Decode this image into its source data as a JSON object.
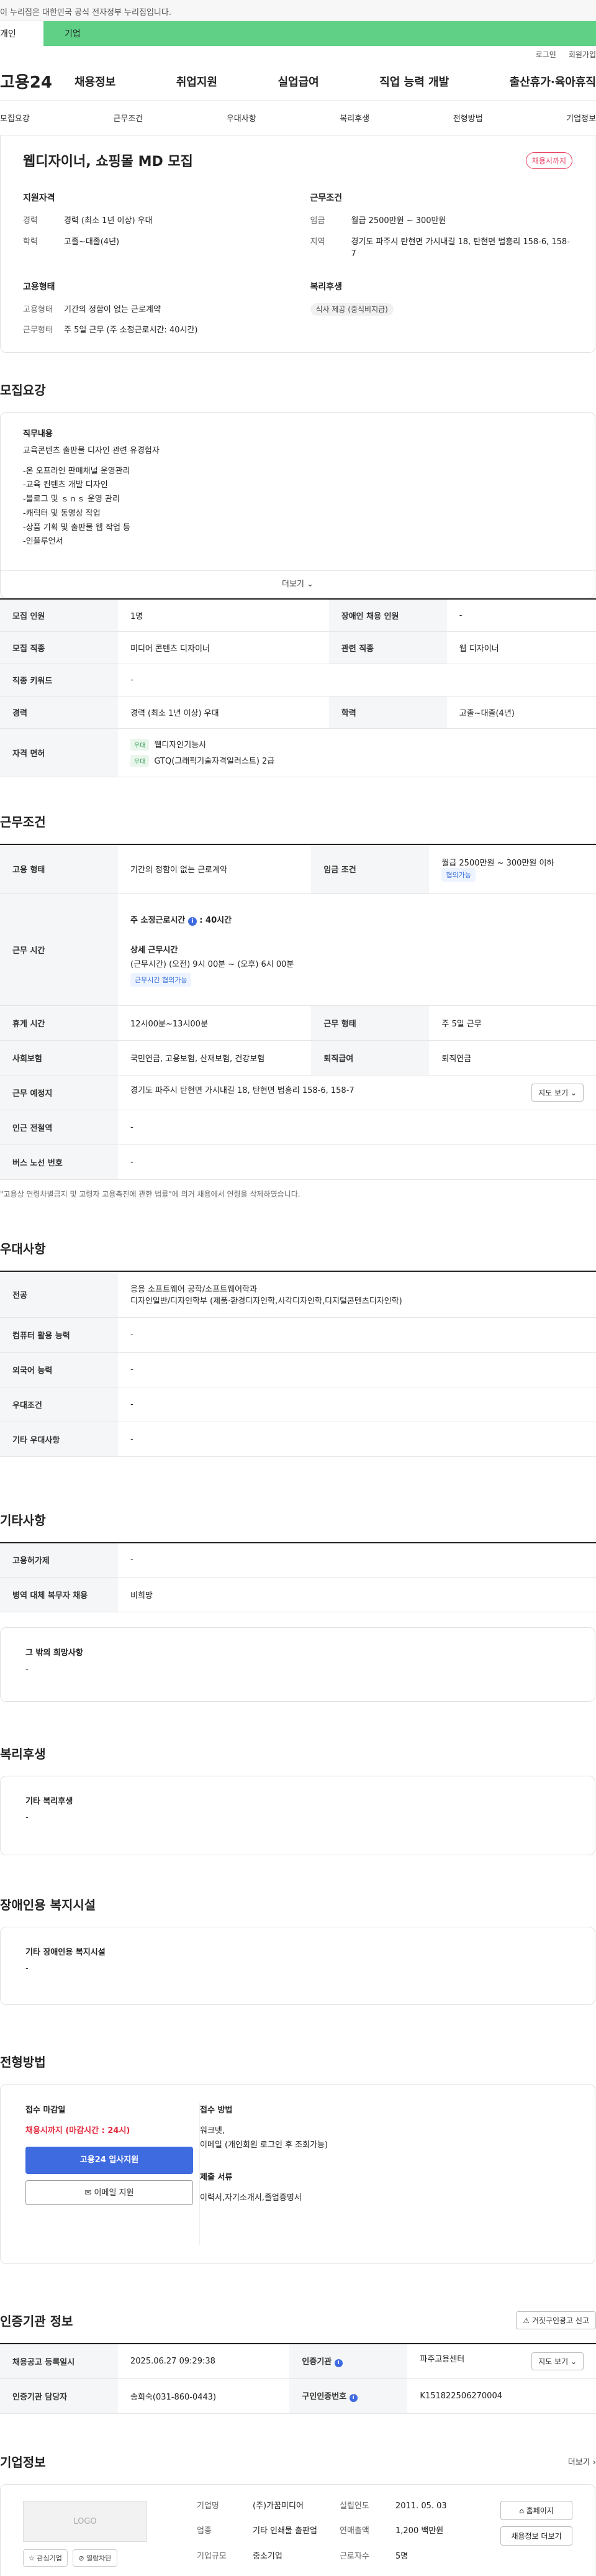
{
  "topbar": {
    "gov_text": "이 누리집은 대한민국 공식 전자정부 누리집입니다.",
    "tab1": "개인",
    "tab2": "기업",
    "login": "로그인",
    "join": "회원가입"
  },
  "gnb": {
    "logo": "고용24",
    "menu": [
      "채용정보",
      "취업지원",
      "실업급여",
      "직업 능력 개발",
      "출산휴가·육아휴직"
    ]
  },
  "subnav": [
    "모집요강",
    "근무조건",
    "우대사항",
    "복리후생",
    "전형방법",
    "기업정보"
  ],
  "summary": {
    "title": "웹디자이너, 쇼핑몰 MD 모집",
    "badge": "채용시까지",
    "apply_h": "지원자격",
    "career_k": "경력",
    "career_v": "경력 (최소 1년 이상) 우대",
    "edu_k": "학력",
    "edu_v": "고졸~대졸(4년)",
    "cond_h": "근무조건",
    "wage_k": "임금",
    "wage_v": "월급 2500만원 ~ 300만원",
    "loc_k": "지역",
    "loc_v": "경기도 파주시 탄현면 가시내길 18, 탄현면 법흥리 158-6, 158-7",
    "emp_h": "고용형태",
    "etype_k": "고용형태",
    "etype_v": "기간의 정함이 없는 근로계약",
    "work_k": "근무형태",
    "work_v": "주 5일 근무 (주 소정근로시간: 40시간)",
    "welf_h": "복리후생",
    "welf_v": "식사 제공 (중식비지급)"
  },
  "recruit": {
    "h": "모집요강",
    "desc_h": "직무내용",
    "desc": [
      "교육콘텐츠 출판물 디자인 관련 유경험자",
      "",
      "-온 오프라인 판매채널 운영관리",
      "-교육 컨텐츠 개발 디자인",
      "-블로그 및 ｓｎｓ 운영 관리",
      "-캐릭터 및 동영상 작업",
      "-상품 기획 및 출판물 웹 작업 등",
      "-인플루언서"
    ],
    "more": "더보기",
    "rows": {
      "num_k": "모집 인원",
      "num_v": "1명",
      "dis_k": "장애인 채용 인원",
      "dis_v": "-",
      "job_k": "모집 직종",
      "job_v": "미디어 콘텐츠 디자이너",
      "rel_k": "관련 직종",
      "rel_v": "웹 디자이너",
      "kw_k": "직종 키워드",
      "kw_v": "-",
      "car_k": "경력",
      "car_v": "경력 (최소 1년 이상) 우대",
      "edu_k": "학력",
      "edu_v": "고졸~대졸(4년)",
      "lic_k": "자격 면허",
      "lic_tag": "우대",
      "lic1": "웹디자인기능사",
      "lic2": "GTQ(그래픽기술자격일러스트) 2급"
    }
  },
  "work": {
    "h": "근무조건",
    "emp_k": "고용 형태",
    "emp_v": "기간의 정함이 없는 근로계약",
    "wage_k": "임금 조건",
    "wage_v": "월급 2500만원 ~ 300만원 이하",
    "wage_tag": "협의가능",
    "hours_k": "근무 시간",
    "hours_t": "주 소정근로시간",
    "hours_v": "40시간",
    "detail_t": "상세 근무시간",
    "detail_v": "(근무시간) (오전) 9시 00분 ~ (오후) 6시 00분",
    "detail_tag": "근무시간 협의가능",
    "break_k": "휴게 시간",
    "break_v": "12시00분~13시00분",
    "form_k": "근무 형태",
    "form_v": "주 5일 근무",
    "ins_k": "사회보험",
    "ins_v": "국민연금, 고용보험, 산재보험, 건강보험",
    "ret_k": "퇴직급여",
    "ret_v": "퇴직연금",
    "place_k": "근무 예정지",
    "place_v": "경기도 파주시 탄현면 가시내길 18, 탄현면 법흥리 158-6, 158-7",
    "map": "지도 보기",
    "sub_k": "인근 전철역",
    "sub_v": "-",
    "bus_k": "버스 노선 번호",
    "bus_v": "-",
    "note": "\"고용상 연령차별금지 및 고령자 고용촉진에 관한 법률\"에 의거 채용에서 연령을 삭제하였습니다."
  },
  "pref": {
    "h": "우대사항",
    "maj_k": "전공",
    "maj_v1": "응용 소프트웨어 공학/소프트웨어학과",
    "maj_v2": "디자인일반/디자인학부 (제품·환경디자인학,시각디자인학,디지털콘텐츠디자인학)",
    "pc_k": "컴퓨터 활용 능력",
    "pc_v": "-",
    "lang_k": "외국어 능력",
    "lang_v": "-",
    "cond_k": "우대조건",
    "cond_v": "-",
    "etc_k": "기타 우대사항",
    "etc_v": "-"
  },
  "other": {
    "h": "기타사항",
    "emp_k": "고용허가제",
    "emp_v": "-",
    "mil_k": "병역 대체 복무자 채용",
    "mil_v": "비희망",
    "hope_h": "그 밖의 희망사항",
    "hope_v": "-"
  },
  "welfare": {
    "h": "복리후생",
    "etc_h": "기타 복리후생",
    "etc_v": "-"
  },
  "disab": {
    "h": "장애인용 복지시설",
    "etc_h": "기타 장애인용 복지시설",
    "etc_v": "-"
  },
  "process": {
    "h": "전형방법",
    "deadline_h": "접수 마감일",
    "deadline_v": "채용시까지 (마감시간 : 24시)",
    "btn1": "고용24 입사지원",
    "btn2": "이메일 지원",
    "method_h": "접수 방법",
    "method_v1": "워크넷,",
    "method_v2": "이메일 (개인회원 로그인 후 조회가능)",
    "docs_h": "제출 서류",
    "docs_v": "이력서,자기소개서,졸업증명서"
  },
  "auth": {
    "h": "인증기관 정보",
    "report": "거짓구인광고 신고",
    "reg_k": "채용공고 등록일시",
    "reg_v": "2025.06.27 09:29:38",
    "org_k": "인증기관",
    "org_v": "파주고용센터",
    "map": "지도 보기",
    "mgr_k": "인증기관 담당자",
    "mgr_v": "송희숙(031-860-0443)",
    "num_k": "구인인증번호",
    "num_v": "K151822506270004"
  },
  "company": {
    "h": "기업정보",
    "more": "더보기",
    "logo": "LOGO",
    "fav": "관심기업",
    "ban": "열람차단",
    "name_k": "기업명",
    "name_v": "(주)가꿈미디어",
    "year_k": "설립연도",
    "year_v": "2011. 05. 03",
    "ind_k": "업종",
    "ind_v": "기타 인쇄물 출판업",
    "sales_k": "연매출액",
    "sales_v": "1,200 백만원",
    "size_k": "기업규모",
    "size_v": "중소기업",
    "emp_k": "근로자수",
    "emp_v": "5명",
    "home": "홈페이지",
    "other": "채용정보 더보기"
  }
}
